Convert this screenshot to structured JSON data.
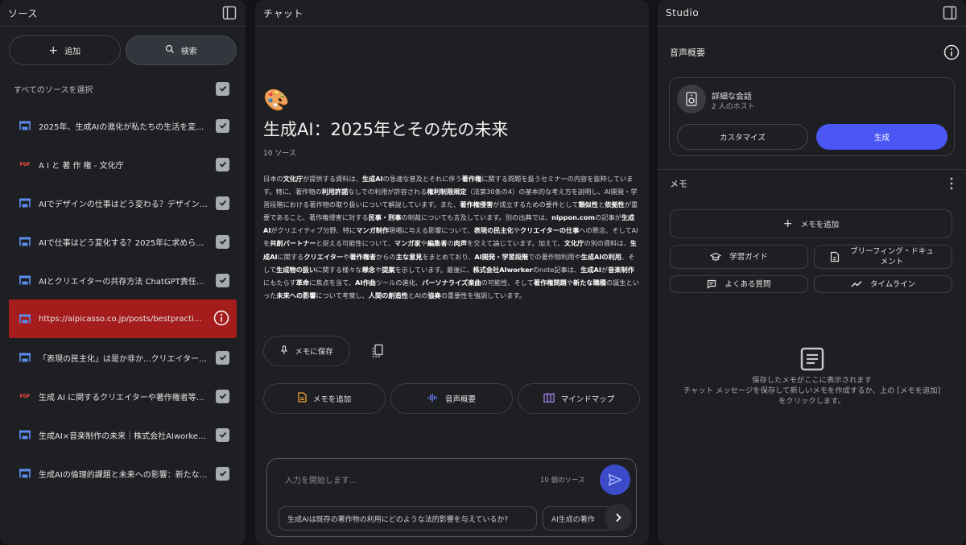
{
  "sources_panel": {
    "title": "ソース",
    "add_label": "追加",
    "search_label": "検索",
    "select_all_label": "すべてのソースを選択",
    "items": [
      {
        "type": "web",
        "label": "2025年、生成AIの進化が私たちの生活を変え...",
        "checked": true
      },
      {
        "type": "pdf",
        "label": "A I と 著 作 権 - 文化庁",
        "checked": true
      },
      {
        "type": "web",
        "label": "AIでデザインの仕事はどう変わる？デザインAI...",
        "checked": true
      },
      {
        "type": "web",
        "label": "AIで仕事はどう変化する？2025年に求められ...",
        "checked": true
      },
      {
        "type": "web",
        "label": "AIとクリエイターの共存方法 ChatGPT責任者...",
        "checked": true
      },
      {
        "type": "web",
        "label": "https://aipicasso.co.jp/posts/bestpractices",
        "checked": false,
        "error": true
      },
      {
        "type": "web",
        "label": "「表現の民主化」は是か非か...クリエイターの...",
        "checked": true
      },
      {
        "type": "pdf",
        "label": "生成 AI に関するクリエイターや著作権者等の...",
        "checked": true
      },
      {
        "type": "web",
        "label": "生成AI×音楽制作の未来｜株式会社AIworker - ...",
        "checked": true
      },
      {
        "type": "web",
        "label": "生成AIの倫理的課題と未来への影響：新たな...",
        "checked": true
      }
    ]
  },
  "chat_panel": {
    "title": "チャット",
    "emoji": "🎨",
    "doc_title": "生成AI：2025年とその先の未来",
    "source_count": "10 ソース",
    "save_memo_label": "メモに保存",
    "actions": [
      {
        "label": "メモを追加",
        "icon": "note-icon",
        "color": "#f2a33a"
      },
      {
        "label": "音声概要",
        "icon": "audio-wave-icon",
        "color": "#6a7bff"
      },
      {
        "label": "マインドマップ",
        "icon": "mindmap-icon",
        "color": "#a98bff"
      }
    ],
    "input_placeholder": "入力を開始します...",
    "input_source_count": "10 個のソース",
    "suggestions": [
      "生成AIは既存の著作物の利用にどのような法的影響を与えているか?",
      "AI生成の著作"
    ]
  },
  "studio_panel": {
    "title": "Studio",
    "audio_section_label": "音声概要",
    "audio_card": {
      "title": "詳細な会話",
      "subtitle": "2 人のホスト",
      "customize_label": "カスタマイズ",
      "generate_label": "生成"
    },
    "memo_section_label": "メモ",
    "add_memo_label": "メモを追加",
    "memo_buttons": [
      {
        "label": "学習ガイド",
        "icon": "graduation-cap-icon"
      },
      {
        "label": "ブリーフィング・ドキュメント",
        "icon": "document-icon"
      },
      {
        "label": "よくある質問",
        "icon": "faq-icon"
      },
      {
        "label": "タイムライン",
        "icon": "timeline-icon"
      }
    ],
    "empty_line1": "保存したメモがここに表示されます",
    "empty_line2": "チャット メッセージを保存して新しいメモを作成するか、上の [メモを追加]",
    "empty_line3": "をクリックします。"
  }
}
